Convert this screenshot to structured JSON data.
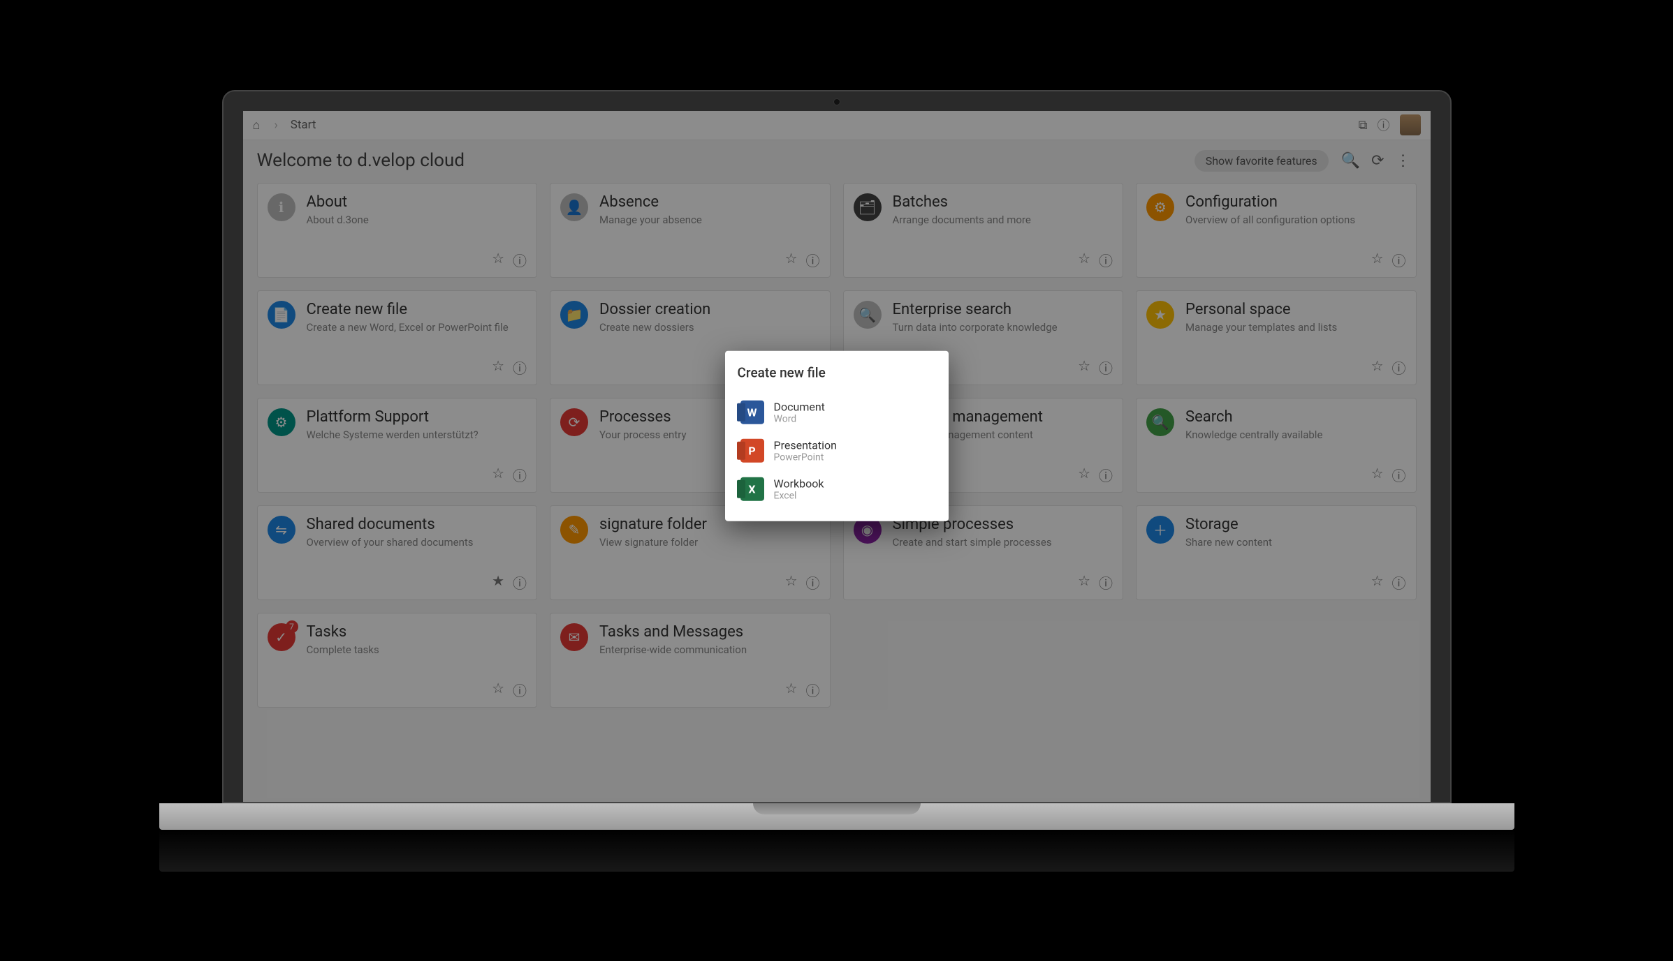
{
  "breadcrumb": {
    "label": "Start"
  },
  "header": {
    "title": "Welcome to d.velop cloud",
    "chip": "Show favorite features"
  },
  "cards": [
    {
      "title": "About",
      "desc": "About d.3one",
      "color": "c-grey",
      "glyph": "ℹ"
    },
    {
      "title": "Absence",
      "desc": "Manage your absence",
      "color": "c-grey",
      "glyph": "👤"
    },
    {
      "title": "Batches",
      "desc": "Arrange documents and more",
      "color": "c-dark",
      "glyph": "🗂"
    },
    {
      "title": "Configuration",
      "desc": "Overview of all configuration options",
      "color": "c-orange",
      "glyph": "⚙"
    },
    {
      "title": "Create new file",
      "desc": "Create a new Word, Excel or PowerPoint file",
      "color": "c-blue",
      "glyph": "📄"
    },
    {
      "title": "Dossier creation",
      "desc": "Create new dossiers",
      "color": "c-blue",
      "glyph": "📁"
    },
    {
      "title": "Enterprise search",
      "desc": "Turn data into corporate knowledge",
      "color": "c-grey",
      "glyph": "🔍"
    },
    {
      "title": "Personal space",
      "desc": "Manage your templates and lists",
      "color": "c-yellow",
      "glyph": "★"
    },
    {
      "title": "Plattform Support",
      "desc": "Welche Systeme werden unterstützt?",
      "color": "c-teal",
      "glyph": "⚙"
    },
    {
      "title": "Processes",
      "desc": "Your process entry",
      "color": "c-red",
      "glyph": "⟳"
    },
    {
      "title": "Records management",
      "desc": "Records management content",
      "color": "c-grey",
      "glyph": "📋"
    },
    {
      "title": "Search",
      "desc": "Knowledge centrally available",
      "color": "c-green",
      "glyph": "🔍"
    },
    {
      "title": "Shared documents",
      "desc": "Overview of your shared documents",
      "color": "c-blue",
      "glyph": "⇋",
      "starred": true
    },
    {
      "title": "signature folder",
      "desc": "View signature folder",
      "color": "c-orange",
      "glyph": "✎"
    },
    {
      "title": "Simple processes",
      "desc": "Create and start simple processes",
      "color": "c-purple",
      "glyph": "◉"
    },
    {
      "title": "Storage",
      "desc": "Share new content",
      "color": "c-blue",
      "glyph": "＋"
    },
    {
      "title": "Tasks",
      "desc": "Complete tasks",
      "color": "c-red",
      "glyph": "✓",
      "badge": "7"
    },
    {
      "title": "Tasks and Messages",
      "desc": "Enterprise-wide communication",
      "color": "c-red",
      "glyph": "✉"
    }
  ],
  "modal": {
    "title": "Create new file",
    "items": [
      {
        "title": "Document",
        "sub": "Word",
        "bg": "#2b579a",
        "letter": "W"
      },
      {
        "title": "Presentation",
        "sub": "PowerPoint",
        "bg": "#d24726",
        "letter": "P"
      },
      {
        "title": "Workbook",
        "sub": "Excel",
        "bg": "#217346",
        "letter": "X"
      }
    ]
  }
}
